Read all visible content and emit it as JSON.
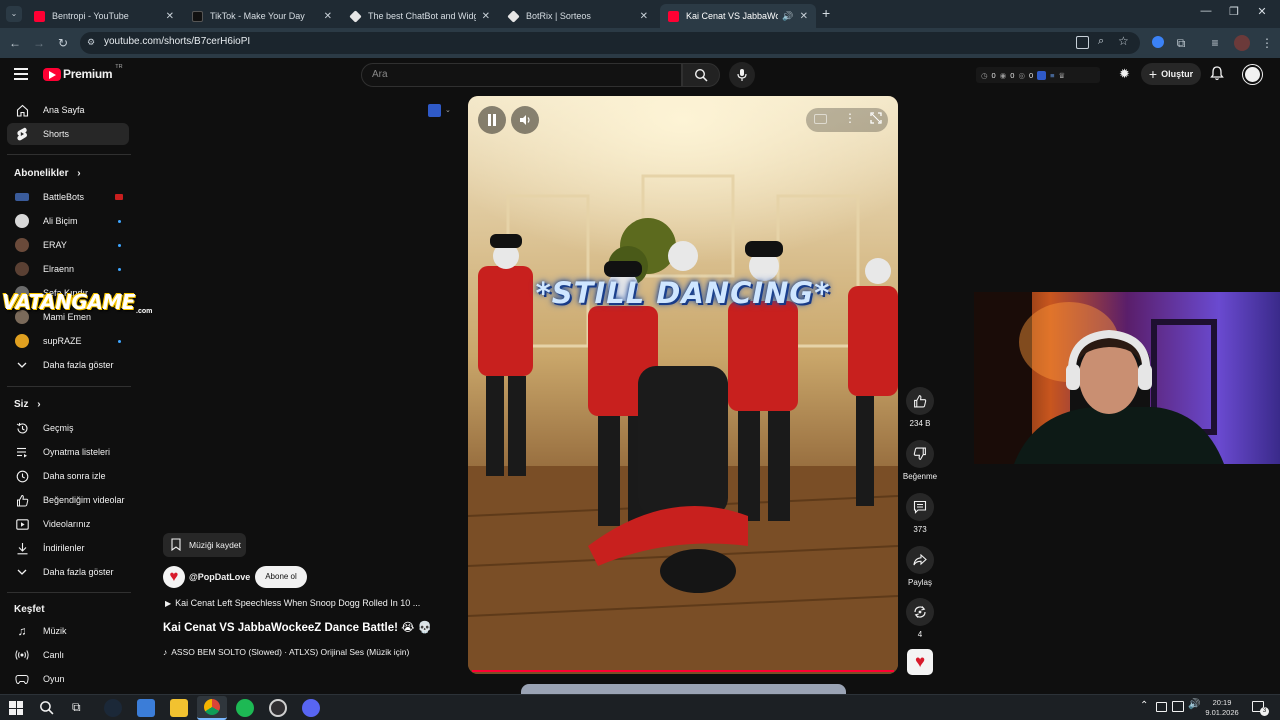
{
  "browser": {
    "tabs": [
      {
        "title": "Bentropi - YouTube",
        "favicon_color": "#ff0033"
      },
      {
        "title": "TikTok - Make Your Day",
        "favicon_color": "#111111"
      },
      {
        "title": "The best ChatBot and Widgets",
        "favicon_color": "#e6e6e6"
      },
      {
        "title": "BotRix | Sorteos",
        "favicon_color": "#e6e6e6"
      },
      {
        "title": "Kai Cenat VS JabbaWockeeZ",
        "favicon_color": "#ff0033"
      }
    ],
    "new_tab_label": "+",
    "url": "youtube.com/shorts/B7cerH6ioPI"
  },
  "header": {
    "logo_text": "Premium",
    "logo_badge": "TR",
    "search_placeholder": "Ara",
    "counters": [
      "0",
      "0",
      "0"
    ],
    "create_label": "Oluştur"
  },
  "sidebar": {
    "main": [
      {
        "label": "Ana Sayfa",
        "icon": "home-icon"
      },
      {
        "label": "Shorts",
        "icon": "shorts-icon",
        "active": true
      }
    ],
    "subscriptions_header": "Abonelikler",
    "subscriptions": [
      {
        "label": "BattleBots",
        "avatar_color": "#3a5b9a"
      },
      {
        "label": "Ali Biçim",
        "avatar_color": "#d8d8d8"
      },
      {
        "label": "ERAY",
        "avatar_color": "#6a4a3a"
      },
      {
        "label": "Elraenn",
        "avatar_color": "#5a4033"
      },
      {
        "label": "Sefa Kındır",
        "avatar_color": "#6b6b6b"
      },
      {
        "label": "Mami Emen",
        "avatar_color": "#7a6a5a"
      },
      {
        "label": "supRAZE",
        "avatar_color": "#e0a020"
      }
    ],
    "show_more_1": "Daha fazla göster",
    "you_header": "Siz",
    "you_items": [
      {
        "label": "Geçmiş",
        "icon": "history-icon"
      },
      {
        "label": "Oynatma listeleri",
        "icon": "playlist-icon"
      },
      {
        "label": "Daha sonra izle",
        "icon": "clock-icon"
      },
      {
        "label": "Beğendiğim videolar",
        "icon": "thumb-up-icon"
      },
      {
        "label": "Videolarınız",
        "icon": "video-icon"
      },
      {
        "label": "İndirilenler",
        "icon": "download-icon"
      }
    ],
    "show_more_2": "Daha fazla göster",
    "explore_header": "Keşfet",
    "explore_items": [
      {
        "label": "Müzik",
        "icon": "music-icon"
      },
      {
        "label": "Canlı",
        "icon": "live-icon"
      },
      {
        "label": "Oyun",
        "icon": "game-icon"
      }
    ]
  },
  "short": {
    "caption": "*STILL DANCING*",
    "save_music": "Müziği kaydet",
    "channel": "@PopDatLove",
    "subscribe": "Abone ol",
    "related_video": "Kai Cenat Left Speechless When Snoop Dogg Rolled In 10 ...",
    "title": "Kai Cenat VS JabbaWockeeZ Dance Battle! 😭 💀",
    "audio": "ASSO BEM SOLTO (Slowed) · ATLXS)    Orijinal Ses (Müzik için)",
    "progress": 0.01
  },
  "actions": {
    "likes": "234 B",
    "dislike": "Beğenme",
    "comments": "373",
    "share": "Paylaş",
    "remix": "4"
  },
  "watermark": {
    "text": "VATANGAME",
    "sub": ".com"
  },
  "taskbar": {
    "time": "20:19",
    "date": "9.01.2026",
    "notifications": "3"
  }
}
